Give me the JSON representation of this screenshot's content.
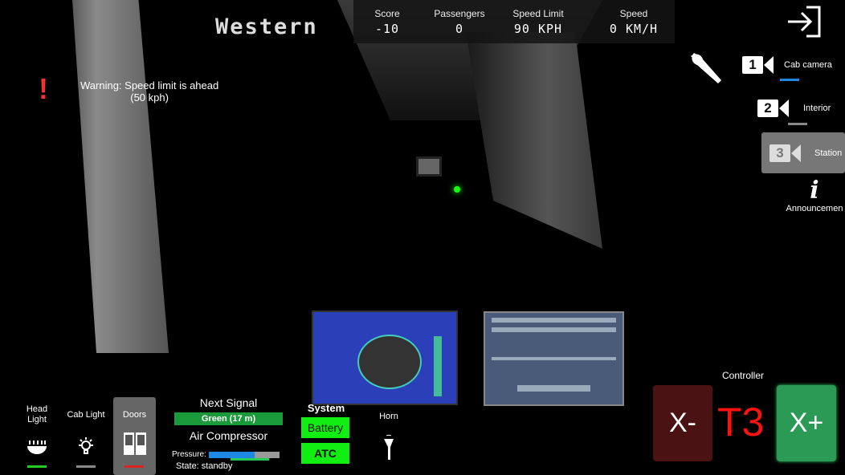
{
  "hud": {
    "line_name": "Western",
    "stats": [
      {
        "label": "Score",
        "value": "-10"
      },
      {
        "label": "Passengers",
        "value": "0"
      },
      {
        "label": "Speed Limit",
        "value": "90 KPH"
      },
      {
        "label": "Speed",
        "value": "0 KM/H"
      }
    ],
    "warning": {
      "icon": "exclamation-icon",
      "line1": "Warning: Speed limit is ahead",
      "line2": "(50 kph)"
    }
  },
  "right_panel": {
    "exit_icon": "exit-icon",
    "settings_icon": "wrench-icon",
    "cameras": [
      {
        "number": "1",
        "label": "Cab camera",
        "indicator_color": "#1e88e5"
      },
      {
        "number": "2",
        "label": "Interior",
        "indicator_color": "#888888"
      },
      {
        "number": "3",
        "label": "Station",
        "selected": true
      }
    ],
    "announcements": {
      "icon": "info-icon",
      "label": "Announcemen"
    }
  },
  "bottom": {
    "head_light": {
      "label1": "Head",
      "label2": "Light",
      "indicator_color": "#22cc22"
    },
    "cab_light": {
      "label": "Cab Light",
      "indicator_color": "#888888"
    },
    "doors": {
      "label": "Doors",
      "indicator_color": "#dd2222",
      "selected": true
    },
    "next_signal": {
      "title": "Next Signal",
      "value": "Green (17 m)",
      "color": "#1a9a3a"
    },
    "air_compressor": {
      "title": "Air Compressor",
      "pressure_label": "Pressure:",
      "pressure_fraction": 0.65,
      "state": "State: standby"
    },
    "system": {
      "title": "System",
      "battery": "Battery",
      "atc": "ATC",
      "color": "#22ee22"
    },
    "horn": {
      "label": "Horn"
    }
  },
  "controller": {
    "title": "Controller",
    "minus": "X-",
    "notch": "T3",
    "plus": "X+",
    "minus_color": "#4a1212",
    "plus_color": "#2a9a55",
    "notch_color": "#ff1111"
  }
}
